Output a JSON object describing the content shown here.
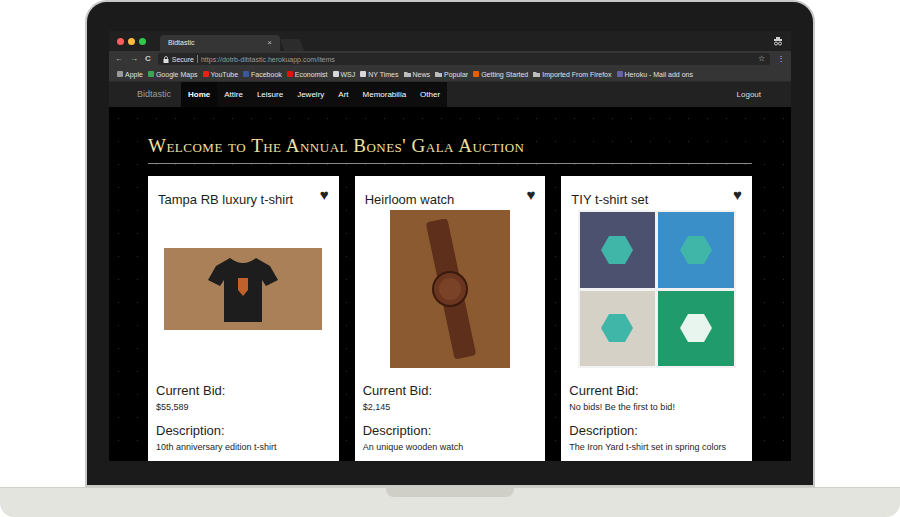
{
  "window": {
    "title": "Bidtastic",
    "close": "×"
  },
  "toolbar": {
    "back": "←",
    "forward": "→",
    "reload": "C",
    "secure": "Secure",
    "url": "https://dotrb-dibtastic.herokuapp.com/items",
    "star": "☆",
    "menu": "⋮"
  },
  "bookmarks": [
    {
      "label": "Apple",
      "kind": "site",
      "color": "#9a9a9a"
    },
    {
      "label": "Google Maps",
      "kind": "site",
      "color": "#34a853"
    },
    {
      "label": "YouTube",
      "kind": "site",
      "color": "#e62117"
    },
    {
      "label": "Facebook",
      "kind": "site",
      "color": "#3b5998"
    },
    {
      "label": "Economist",
      "kind": "site",
      "color": "#e3120b"
    },
    {
      "label": "WSJ",
      "kind": "site",
      "color": "#d8d8d8"
    },
    {
      "label": "NY Times",
      "kind": "site",
      "color": "#d8d8d8"
    },
    {
      "label": "News",
      "kind": "folder",
      "color": "#bdbdbd"
    },
    {
      "label": "Popular",
      "kind": "folder",
      "color": "#bdbdbd"
    },
    {
      "label": "Getting Started",
      "kind": "site",
      "color": "#e66000"
    },
    {
      "label": "Imported From Firefox",
      "kind": "folder",
      "color": "#bdbdbd"
    },
    {
      "label": "Heroku - Mail add ons",
      "kind": "site",
      "color": "#6762a6"
    }
  ],
  "nav": {
    "brand": "Bidtastic",
    "items": [
      {
        "label": "Home",
        "selected": true
      },
      {
        "label": "Attire",
        "selected": false
      },
      {
        "label": "Leisure",
        "selected": false
      },
      {
        "label": "Jewelry",
        "selected": false
      },
      {
        "label": "Art",
        "selected": false
      },
      {
        "label": "Memorabilia",
        "selected": false
      },
      {
        "label": "Other",
        "selected": false
      }
    ],
    "logout": "Logout"
  },
  "heading": "Welcome to The Annual Bones' Gala Auction",
  "cards": [
    {
      "title": "Tampa RB luxury t-shirt",
      "heart": "♥",
      "kind": "shirt",
      "bid_label": "Current Bid:",
      "bid": "$55,589",
      "description_label": "Description:",
      "description": "10th anniversary edition t-shirt"
    },
    {
      "title": "Heirloom watch",
      "heart": "♥",
      "kind": "watch",
      "bid_label": "Current Bid:",
      "bid": "$2,145",
      "description_label": "Description:",
      "description": "An unique wooden watch"
    },
    {
      "title": "TIY t-shirt set",
      "heart": "♥",
      "kind": "shirts",
      "bid_label": "Current Bid:",
      "bid": "No bids! Be the first to bid!",
      "description_label": "Description:",
      "description": "The Iron Yard t-shirt set in spring colors"
    }
  ]
}
